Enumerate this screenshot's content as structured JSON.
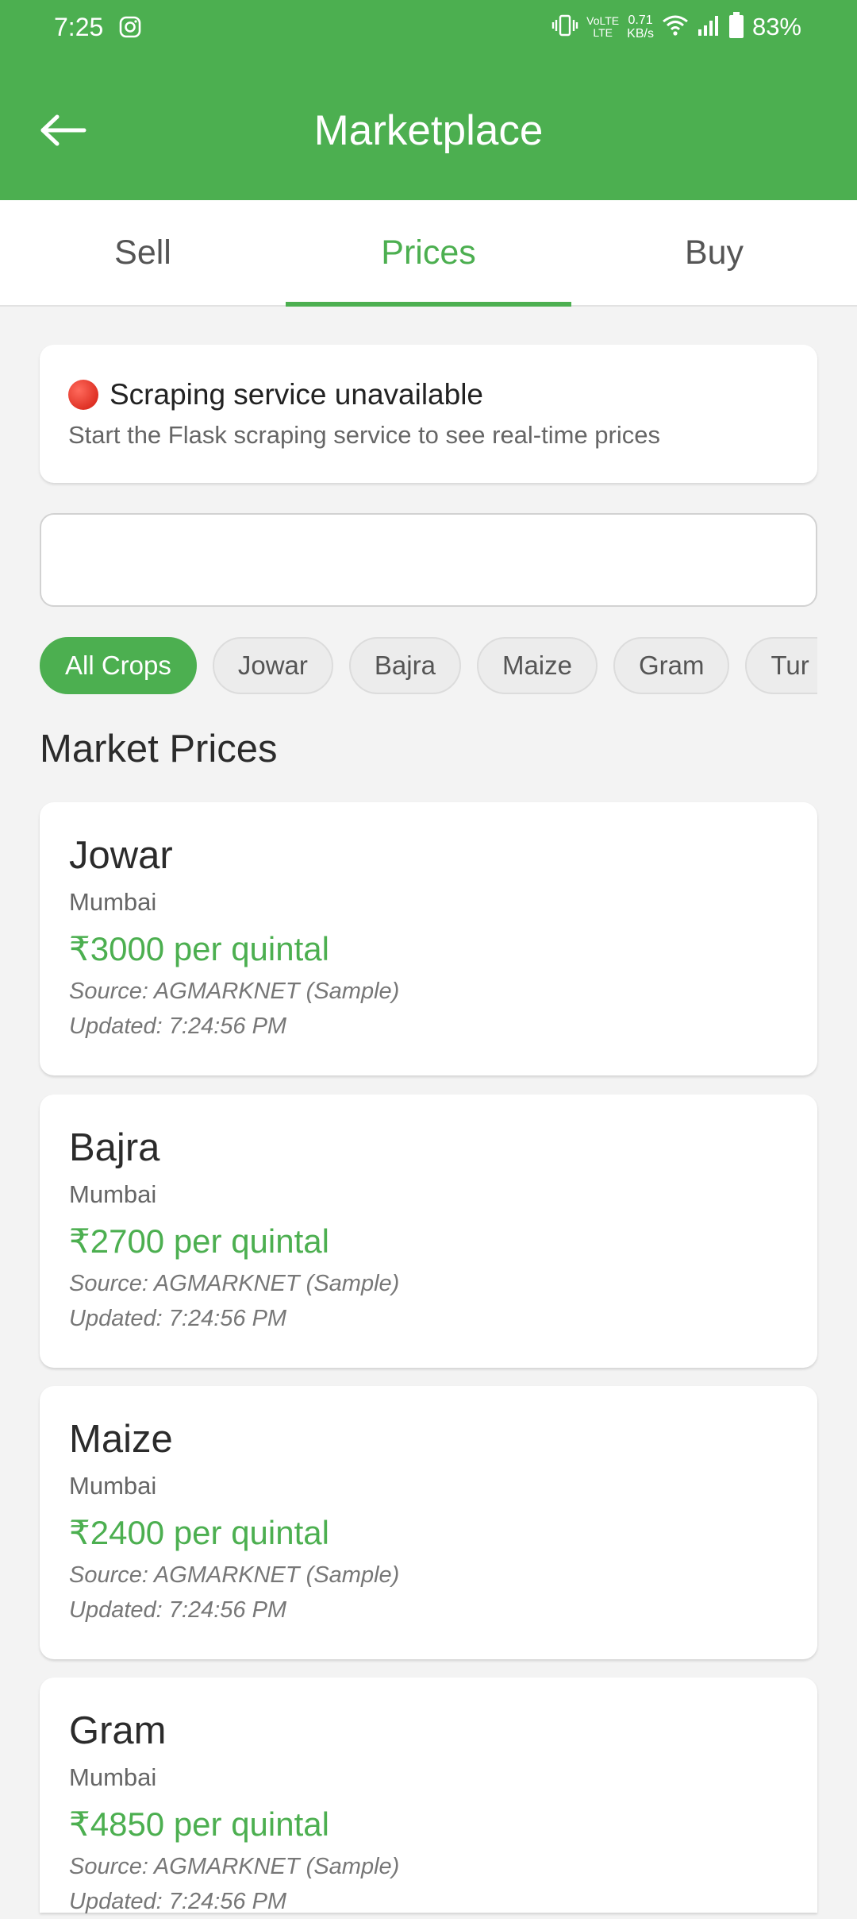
{
  "status_bar": {
    "time": "7:25",
    "net_speed_value": "0.71",
    "net_speed_unit": "KB/s",
    "network_label_top": "VoLTE",
    "network_label_bottom": "LTE",
    "battery": "83%"
  },
  "header": {
    "title": "Marketplace"
  },
  "tabs": [
    {
      "label": "Sell",
      "active": false
    },
    {
      "label": "Prices",
      "active": true
    },
    {
      "label": "Buy",
      "active": false
    }
  ],
  "alert": {
    "title": "Scraping service unavailable",
    "message": "Start the Flask scraping service to see real-time prices"
  },
  "search": {
    "value": "",
    "placeholder": ""
  },
  "filters": [
    {
      "label": "All Crops",
      "active": true
    },
    {
      "label": "Jowar",
      "active": false
    },
    {
      "label": "Bajra",
      "active": false
    },
    {
      "label": "Maize",
      "active": false
    },
    {
      "label": "Gram",
      "active": false
    },
    {
      "label": "Tur (",
      "active": false
    }
  ],
  "section_title": "Market Prices",
  "prices": [
    {
      "crop": "Jowar",
      "location": "Mumbai",
      "price": "₹3000 per quintal",
      "source": "Source: AGMARKNET (Sample)",
      "updated": "Updated: 7:24:56 PM"
    },
    {
      "crop": "Bajra",
      "location": "Mumbai",
      "price": "₹2700 per quintal",
      "source": "Source: AGMARKNET (Sample)",
      "updated": "Updated: 7:24:56 PM"
    },
    {
      "crop": "Maize",
      "location": "Mumbai",
      "price": "₹2400 per quintal",
      "source": "Source: AGMARKNET (Sample)",
      "updated": "Updated: 7:24:56 PM"
    },
    {
      "crop": "Gram",
      "location": "Mumbai",
      "price": "₹4850 per quintal",
      "source": "Source: AGMARKNET (Sample)",
      "updated": "Updated: 7:24:56 PM"
    }
  ],
  "colors": {
    "accent": "#4caf50",
    "background": "#f3f3f3",
    "card": "#ffffff",
    "alert_dot": "#e53935"
  },
  "icons": {
    "back": "arrow-left-icon",
    "instagram": "instagram-icon",
    "vibrate": "vibrate-icon",
    "wifi": "wifi-icon",
    "signal": "signal-icon",
    "battery": "battery-icon",
    "alert": "red-circle-icon"
  }
}
